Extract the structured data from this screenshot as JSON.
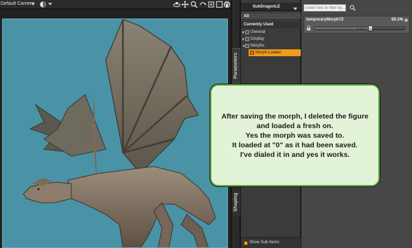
{
  "viewport": {
    "camera_label": "Default Camera",
    "icons": [
      "shading-mode-icon",
      "orbit-icon",
      "pan-icon",
      "zoom-icon",
      "rotate-icon",
      "frame-icon",
      "maximize-icon",
      "reset-icon"
    ]
  },
  "side_tabs": {
    "parameters": "Parameters",
    "shaping": "Shaping"
  },
  "tree": {
    "node_name": "SubDragonLE",
    "rows": {
      "all": "All",
      "currently_used": "Currently Used",
      "general": "General",
      "display": "Display",
      "morphs": "Morphs",
      "morph_loader": "Morph Loader"
    },
    "show_sub_items": "Show Sub Items"
  },
  "properties": {
    "filter_placeholder": "Enter text to filter by...",
    "slider": {
      "name": "temporaryMorph72",
      "value_text": "50.1%",
      "fraction": 0.62
    }
  },
  "callout": {
    "lines": [
      "After saving the morph, I deleted the figure",
      "and loaded a fresh on.",
      "Yes the morph was saved to.",
      "It loaded at \"0\" as it had been saved.",
      "I've dialed it in and yes it works."
    ]
  },
  "colors": {
    "accent_orange": "#f09a1e",
    "viewport_background": "#4a93a7",
    "callout_fill": "#e3f3d7",
    "callout_border": "#63ab3f"
  }
}
